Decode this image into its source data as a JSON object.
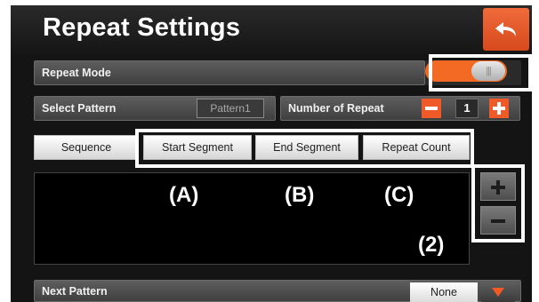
{
  "header": {
    "title": "Repeat Settings",
    "back_icon": "back-arrow-icon"
  },
  "repeat_mode": {
    "label": "Repeat Mode",
    "toggle_state": "on",
    "accent": "#F26A24"
  },
  "select_pattern": {
    "label": "Select Pattern",
    "value": "Pattern1"
  },
  "number_of_repeat": {
    "label": "Number of Repeat",
    "value": "1",
    "decrement_icon": "minus-icon",
    "increment_icon": "plus-icon"
  },
  "tabs": [
    "Sequence",
    "Start Segment",
    "End Segment",
    "Repeat Count"
  ],
  "annotations": {
    "a": "(A)",
    "b": "(B)",
    "c": "(C)",
    "two": "(2)"
  },
  "side_buttons": {
    "add_icon": "plus-icon",
    "remove_icon": "minus-icon"
  },
  "next_pattern": {
    "label": "Next Pattern",
    "value": "None",
    "dropdown_icon": "triangle-down-icon"
  }
}
